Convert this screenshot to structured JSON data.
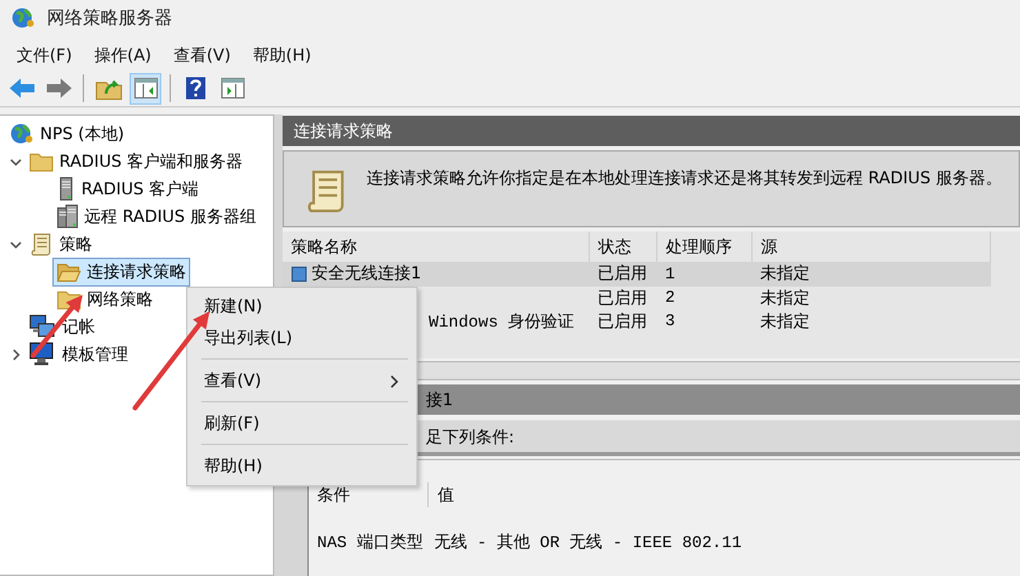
{
  "window": {
    "title": "网络策略服务器"
  },
  "menu_bar": [
    "文件(F)",
    "操作(A)",
    "查看(V)",
    "帮助(H)"
  ],
  "toolbar": {
    "buttons": [
      {
        "pressed": false
      },
      {
        "pressed": false
      },
      {
        "pressed": false
      },
      {
        "pressed": true
      },
      {
        "pressed": false
      },
      {
        "pressed": false
      }
    ]
  },
  "tree": [
    {
      "label": "NPS (本地)",
      "kind": "globe",
      "selected": false,
      "children": [
        {
          "label": "RADIUS 客户端和服务器",
          "kind": "folder",
          "selected": false,
          "expanded": true,
          "children": [
            {
              "label": "RADIUS 客户端",
              "kind": "server",
              "selected": false
            },
            {
              "label": "远程 RADIUS 服务器组",
              "kind": "servers",
              "selected": false
            }
          ]
        },
        {
          "label": "策略",
          "kind": "scroll",
          "selected": false,
          "expanded": true,
          "children": [
            {
              "label": "连接请求策略",
              "kind": "folder-open",
              "selected": true
            },
            {
              "label": "网络策略",
              "kind": "folder",
              "selected": false
            }
          ]
        },
        {
          "label": "记帐",
          "kind": "accounting",
          "selected": false
        },
        {
          "label": "模板管理",
          "kind": "monitor",
          "selected": false,
          "expanded": false
        }
      ]
    }
  ],
  "pane": {
    "title": "连接请求策略",
    "description": "连接请求策略允许你指定是在本地处理连接请求还是将其转发到远程 RADIUS 服务器。"
  },
  "table": {
    "columns": [
      "策略名称",
      "状态",
      "处理顺序",
      "源"
    ],
    "rows": [
      {
        "name": "安全无线连接1",
        "status": "已启用",
        "order": "1",
        "source": "未指定",
        "selected": true
      },
      {
        "status": "已启用",
        "order": "2",
        "source": "未指定",
        "selected": false
      },
      {
        "name": "Windows 身份验证",
        "status": "已启用",
        "order": "3",
        "source": "未指定",
        "selected": false
      }
    ]
  },
  "details": {
    "title": "接1",
    "subtitle": "足下列条件:",
    "columns": [
      "条件",
      "值"
    ],
    "rows": [
      {
        "condition": "NAS 端口类型",
        "value": "无线 - 其他 OR 无线 - IEEE 802.11"
      }
    ]
  },
  "context_menu": [
    {
      "kind": "item",
      "label": "新建(N)"
    },
    {
      "kind": "item",
      "label": "导出列表(L)"
    },
    {
      "kind": "separator"
    },
    {
      "kind": "submenu",
      "label": "查看(V)"
    },
    {
      "kind": "separator"
    },
    {
      "kind": "item",
      "label": "刷新(F)"
    },
    {
      "kind": "separator"
    },
    {
      "kind": "item",
      "label": "帮助(H)"
    }
  ],
  "annotations": [
    {
      "kind": "arrow"
    },
    {
      "kind": "arrow"
    }
  ]
}
